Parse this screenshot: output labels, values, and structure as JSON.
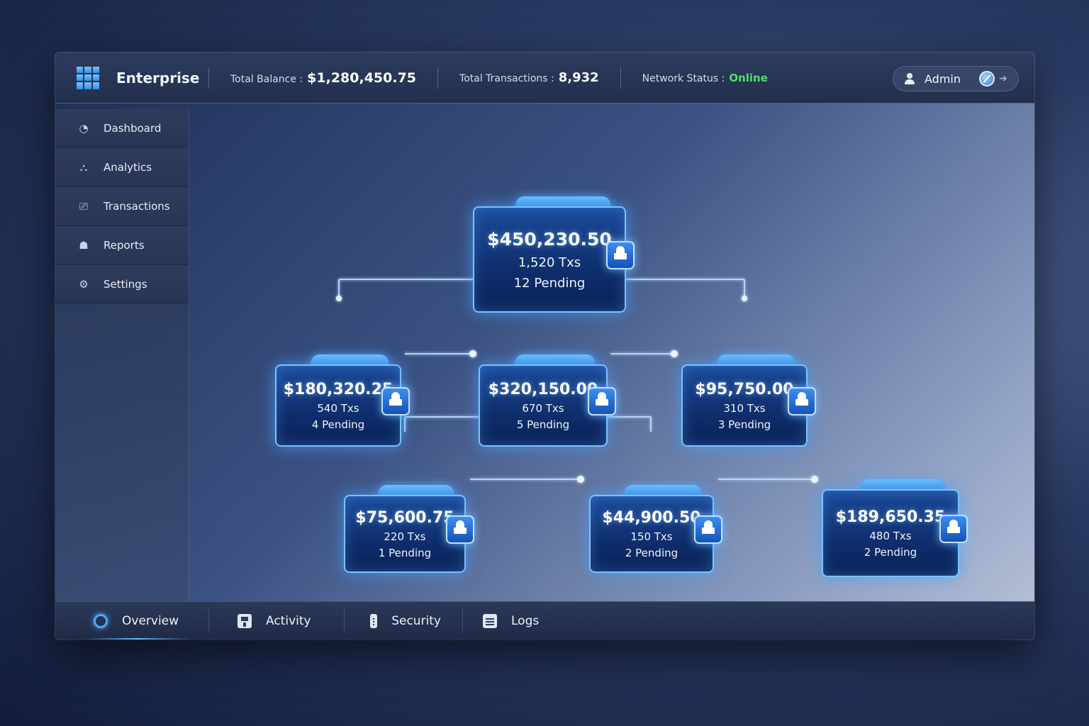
{
  "header": {
    "brand": "Enterprise",
    "total_balance_label": "Total Balance :",
    "total_balance": "$1,280,450.75",
    "total_transactions_label": "Total Transactions :",
    "total_transactions": "8,932",
    "network_status_label": "Network Status :",
    "network_status": "Online",
    "user": "Admin",
    "status_color": "#4fe06a"
  },
  "sidebar": {
    "items": [
      {
        "label": "Dashboard",
        "icon": "dashboard-icon"
      },
      {
        "label": "Analytics",
        "icon": "analytics-icon"
      },
      {
        "label": "Transactions",
        "icon": "transactions-icon"
      },
      {
        "label": "Reports",
        "icon": "reports-icon"
      },
      {
        "label": "Settings",
        "icon": "settings-icon"
      }
    ]
  },
  "nodes": [
    {
      "amount": "$450,230.50",
      "txs": "1,520 Txs",
      "pending": "12 Pending"
    },
    {
      "amount": "$180,320.25",
      "txs": "540 Txs",
      "pending": "4 Pending"
    },
    {
      "amount": "$320,150.00",
      "txs": "670 Txs",
      "pending": "5 Pending"
    },
    {
      "amount": "$95,750.00",
      "txs": "310 Txs",
      "pending": "3 Pending"
    },
    {
      "amount": "$75,600.75",
      "txs": "220 Txs",
      "pending": "1 Pending"
    },
    {
      "amount": "$44,900.50",
      "txs": "150 Txs",
      "pending": "2 Pending"
    },
    {
      "amount": "$189,650.35",
      "txs": "480 Txs",
      "pending": "2 Pending"
    }
  ],
  "bottom_tabs": [
    {
      "label": "Overview",
      "icon": "ring-icon",
      "active": true
    },
    {
      "label": "Activity",
      "icon": "activity-icon"
    },
    {
      "label": "Security",
      "icon": "security-icon"
    },
    {
      "label": "Logs",
      "icon": "logs-icon"
    }
  ],
  "colors": {
    "accent": "#4aa8ff",
    "node_border": "#7ac2ff",
    "online": "#4fe06a"
  }
}
